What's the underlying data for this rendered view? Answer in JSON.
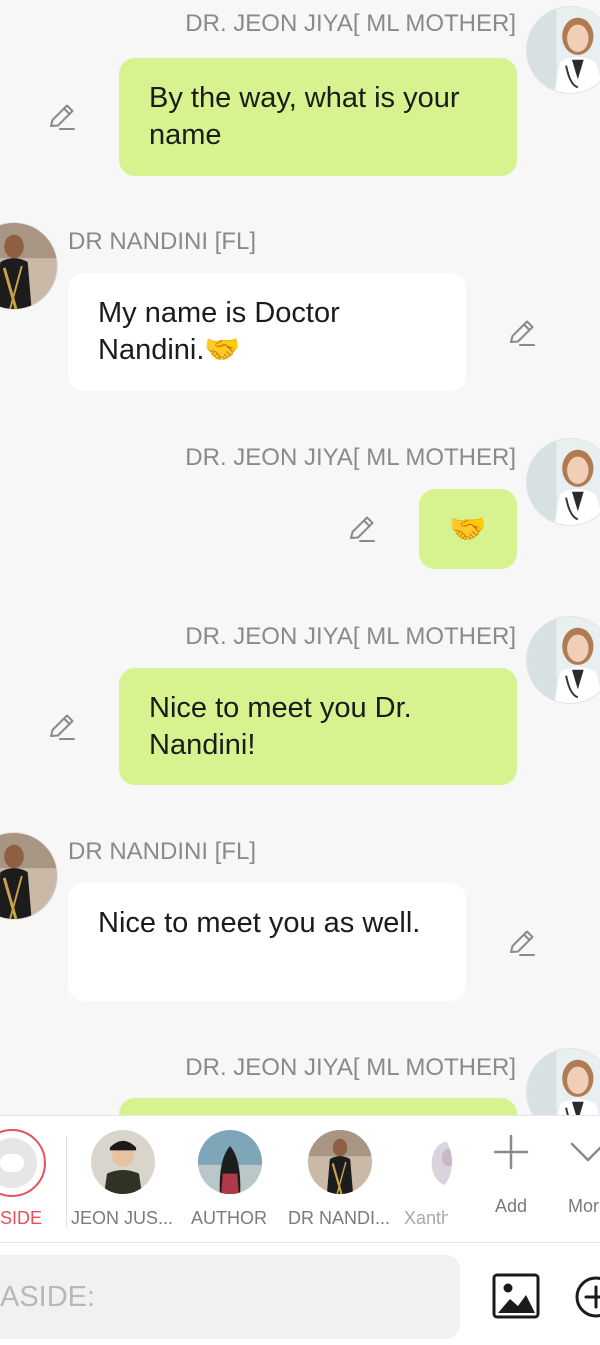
{
  "chat": {
    "messages": [
      {
        "sender": "DR. JEON JIYA[ ML MOTHER]",
        "side": "right",
        "text": "By the way, what is your name"
      },
      {
        "sender": "DR NANDINI [FL]",
        "side": "left",
        "text": "My name is Doctor Nandini.🤝"
      },
      {
        "sender": "DR. JEON JIYA[ ML MOTHER]",
        "side": "right",
        "text": "🤝"
      },
      {
        "sender": "DR. JEON JIYA[ ML MOTHER]",
        "side": "right",
        "text": "Nice to meet you Dr. Nandini!"
      },
      {
        "sender": "DR NANDINI [FL]",
        "side": "left",
        "text": "Nice to meet you as well."
      },
      {
        "sender": "DR. JEON JIYA[ ML MOTHER]",
        "side": "right",
        "text": ""
      }
    ]
  },
  "charbar": {
    "aside_label": "SIDE",
    "characters": [
      {
        "label": "JEON JUS..."
      },
      {
        "label": "AUTHOR"
      },
      {
        "label": "DR NANDI..."
      },
      {
        "label": "Xanth"
      }
    ],
    "add_label": "Add",
    "more_label": "Mor"
  },
  "input": {
    "placeholder": "ASIDE:"
  },
  "colors": {
    "self_bubble": "#d6f38f",
    "other_bubble": "#ffffff",
    "accent": "#e8505b",
    "background": "#f7f7f8"
  },
  "icons": {
    "edit": "pencil-edit-icon",
    "image": "image-icon",
    "add": "plus-icon",
    "more": "chevron-down-icon",
    "aside": "chat-bubble-icon"
  }
}
